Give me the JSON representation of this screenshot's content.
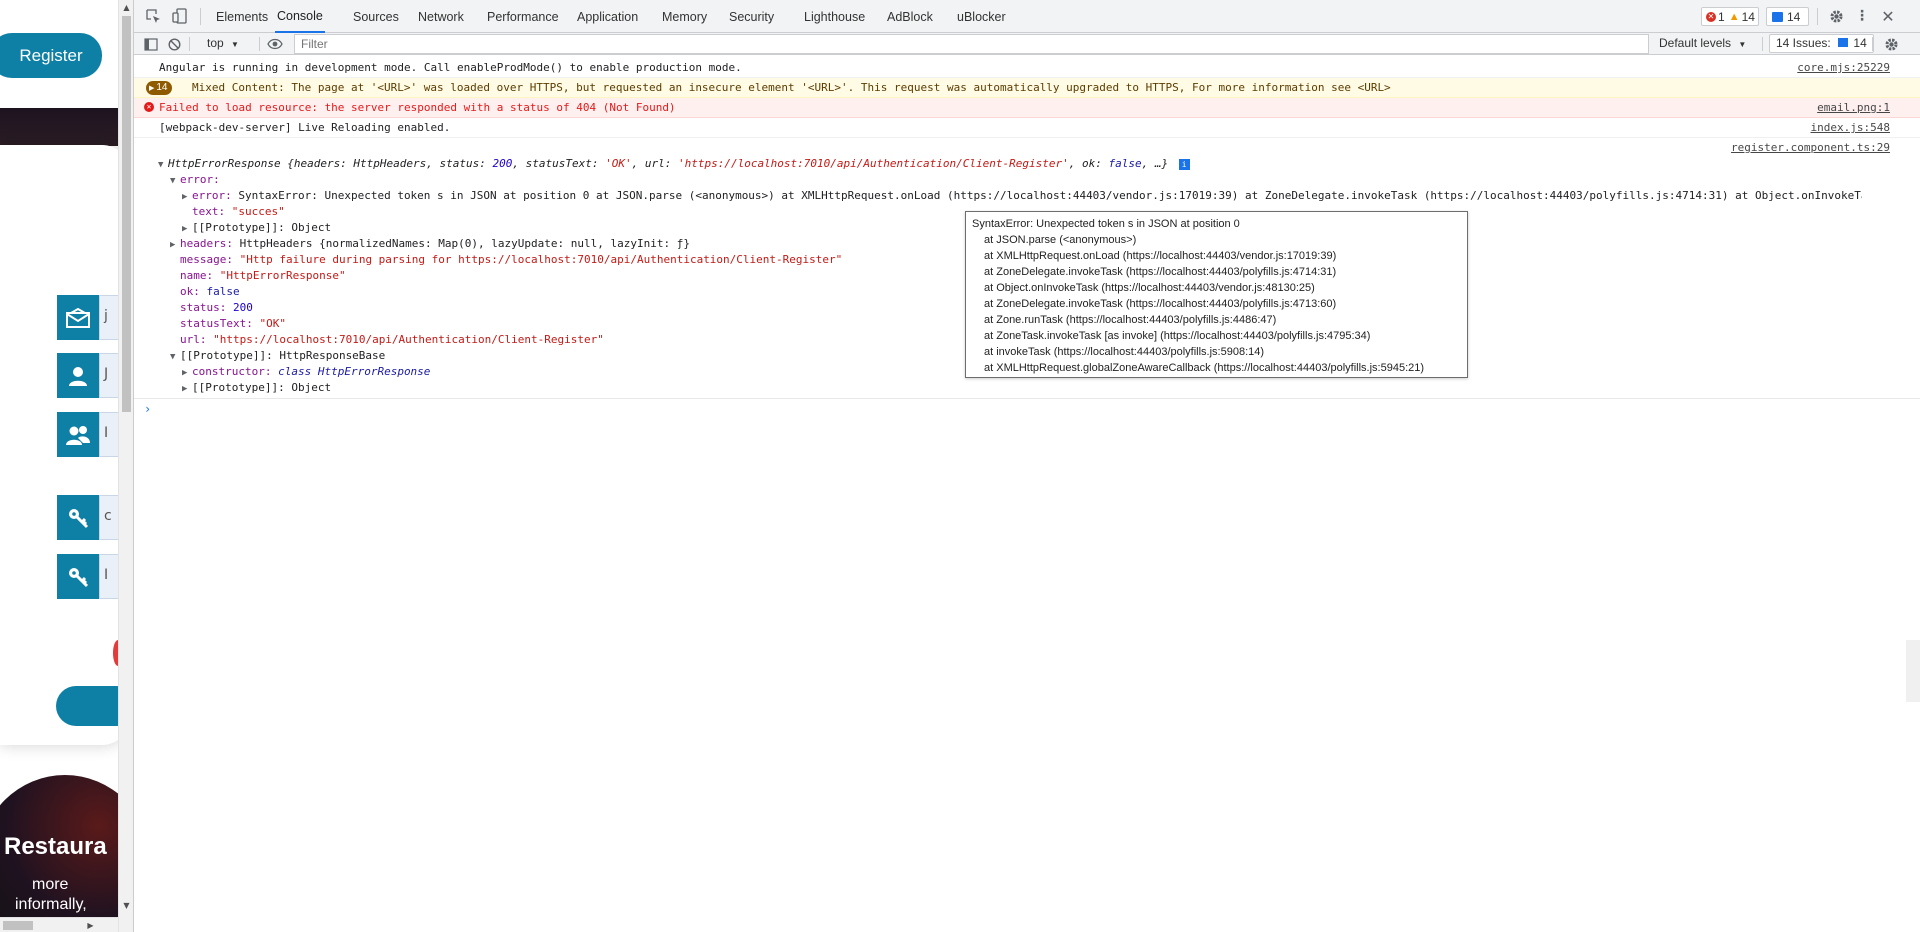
{
  "page": {
    "register_button": "Register",
    "restaurant_title": "Restaura",
    "restaurant_lines": [
      "more",
      "informally,"
    ],
    "field_letters": [
      "j",
      "J",
      "I",
      "c",
      "I"
    ]
  },
  "devtools": {
    "tabs": [
      "Elements",
      "Console",
      "Sources",
      "Network",
      "Performance",
      "Application",
      "Memory",
      "Security",
      "Lighthouse",
      "AdBlock",
      "uBlocker"
    ],
    "active_tab": "Console",
    "error_count": "1",
    "warning_count": "14",
    "info_count": "14",
    "toolbar": {
      "context": "top",
      "filter_placeholder": "Filter",
      "levels": "Default levels",
      "issues_label": "14 Issues:",
      "issues_count": "14"
    },
    "messages": [
      {
        "text": "Angular is running in development mode. Call enableProdMode() to enable production mode.",
        "source": "core.mjs:25229"
      },
      {
        "badge": "14",
        "text": "Mixed Content: The page at '<URL>' was loaded over HTTPS, but requested an insecure element '<URL>'. This request was automatically upgraded to HTTPS, For more information see <URL>",
        "source": ""
      },
      {
        "text": "Failed to load resource: the server responded with a status of 404 (Not Found)",
        "source": "email.png:1"
      },
      {
        "text": "[webpack-dev-server] Live Reloading enabled.",
        "source": "index.js:548"
      }
    ],
    "object_source": "register.component.ts:29",
    "object": {
      "summary_prefix": "HttpErrorResponse {headers: HttpHeaders, status: ",
      "summary_status": "200",
      "summary_mid": ", statusText: ",
      "summary_statustext": "'OK'",
      "summary_url_key": ", url: ",
      "summary_url": "'https://localhost:7010/api/Authentication/Client-Register'",
      "summary_ok_key": ", ok: ",
      "summary_ok": "false",
      "summary_end": ", …}",
      "error_key": "error:",
      "inner_error_key": "error:",
      "inner_error_val": "SyntaxError: Unexpected token s in JSON at position 0 at JSON.parse (<anonymous>) at XMLHttpRequest.onLoad (https://localhost:44403/vendor.js:17019:39) at ZoneDelegate.invokeTask (https://localhost:44403/polyfills.js:4714:31) at Object.onInvokeTas…",
      "text_key": "text:",
      "text_val": "\"succes\"",
      "proto1": "[[Prototype]]: Object",
      "headers_key": "headers:",
      "headers_val": "HttpHeaders {normalizedNames: Map(0), lazyUpdate: null, lazyInit: ƒ}",
      "message_key": "message:",
      "message_val": "\"Http failure during parsing for https://localhost:7010/api/Authentication/Client-Register\"",
      "name_key": "name:",
      "name_val": "\"HttpErrorResponse\"",
      "ok_key": "ok:",
      "ok_val": "false",
      "status_key": "status:",
      "status_val": "200",
      "statustext_key": "statusText:",
      "statustext_val": "\"OK\"",
      "url_key": "url:",
      "url_val": "\"https://localhost:7010/api/Authentication/Client-Register\"",
      "proto2": "[[Prototype]]: HttpResponseBase",
      "constructor_key": "constructor:",
      "constructor_val": "class HttpErrorResponse",
      "proto3": "[[Prototype]]: Object"
    },
    "tooltip_lines": [
      "SyntaxError: Unexpected token s in JSON at position 0",
      "at JSON.parse (<anonymous>)",
      "at XMLHttpRequest.onLoad (https://localhost:44403/vendor.js:17019:39)",
      "at ZoneDelegate.invokeTask (https://localhost:44403/polyfills.js:4714:31)",
      "at Object.onInvokeTask (https://localhost:44403/vendor.js:48130:25)",
      "at ZoneDelegate.invokeTask (https://localhost:44403/polyfills.js:4713:60)",
      "at Zone.runTask (https://localhost:44403/polyfills.js:4486:47)",
      "at ZoneTask.invokeTask [as invoke] (https://localhost:44403/polyfills.js:4795:34)",
      "at invokeTask (https://localhost:44403/polyfills.js:5908:14)",
      "at XMLHttpRequest.globalZoneAwareCallback (https://localhost:44403/polyfills.js:5945:21)"
    ]
  }
}
